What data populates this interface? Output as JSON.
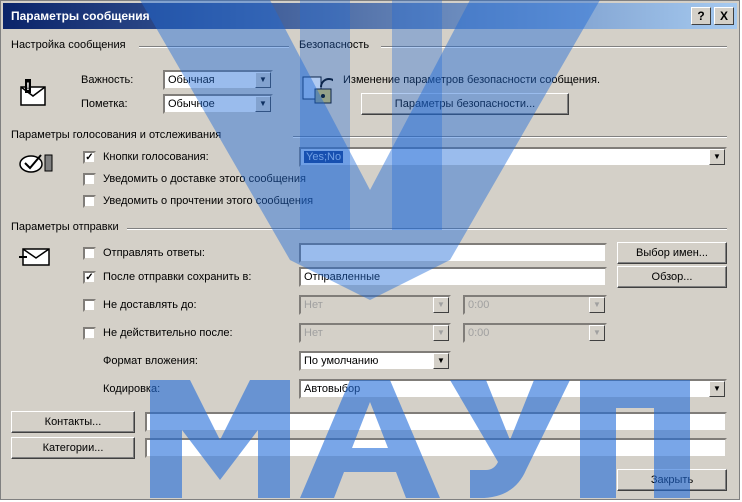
{
  "window": {
    "title": "Параметры сообщения",
    "help_btn": "?",
    "close_btn": "X"
  },
  "settings": {
    "group_title": "Настройка сообщения",
    "importance_label": "Важность:",
    "importance_value": "Обычная",
    "sensitivity_label": "Пометка:",
    "sensitivity_value": "Обычное"
  },
  "security": {
    "group_title": "Безопасность",
    "description": "Изменение параметров безопасности сообщения.",
    "button": "Параметры безопасности..."
  },
  "voting": {
    "group_title": "Параметры голосования и отслеживания",
    "voting_buttons": {
      "label": "Кнопки голосования:",
      "checked": true,
      "value": "Yes;No"
    },
    "delivery_receipt": {
      "label": "Уведомить о доставке этого сообщения",
      "checked": false
    },
    "read_receipt": {
      "label": "Уведомить о прочтении этого сообщения",
      "checked": false
    }
  },
  "delivery": {
    "group_title": "Параметры отправки",
    "replies_to": {
      "label": "Отправлять ответы:",
      "checked": false,
      "value": "",
      "button": "Выбор имен..."
    },
    "save_sent": {
      "label": "После отправки сохранить в:",
      "checked": true,
      "value": "Отправленные",
      "button": "Обзор..."
    },
    "deliver_after": {
      "label": "Не доставлять до:",
      "checked": false,
      "date": "Нет",
      "time": "0:00"
    },
    "expires_after": {
      "label": "Не действительно после:",
      "checked": false,
      "date": "Нет",
      "time": "0:00"
    },
    "attachment_format": {
      "label": "Формат вложения:",
      "value": "По умолчанию"
    },
    "encoding": {
      "label": "Кодировка:",
      "value": "Автовыбор"
    }
  },
  "contacts_button": "Контакты...",
  "contacts_value": "",
  "categories_button": "Категории...",
  "categories_value": "",
  "close_button": "Закрыть",
  "watermark": {
    "text": "МАУП",
    "color": "#1f6ad8"
  }
}
